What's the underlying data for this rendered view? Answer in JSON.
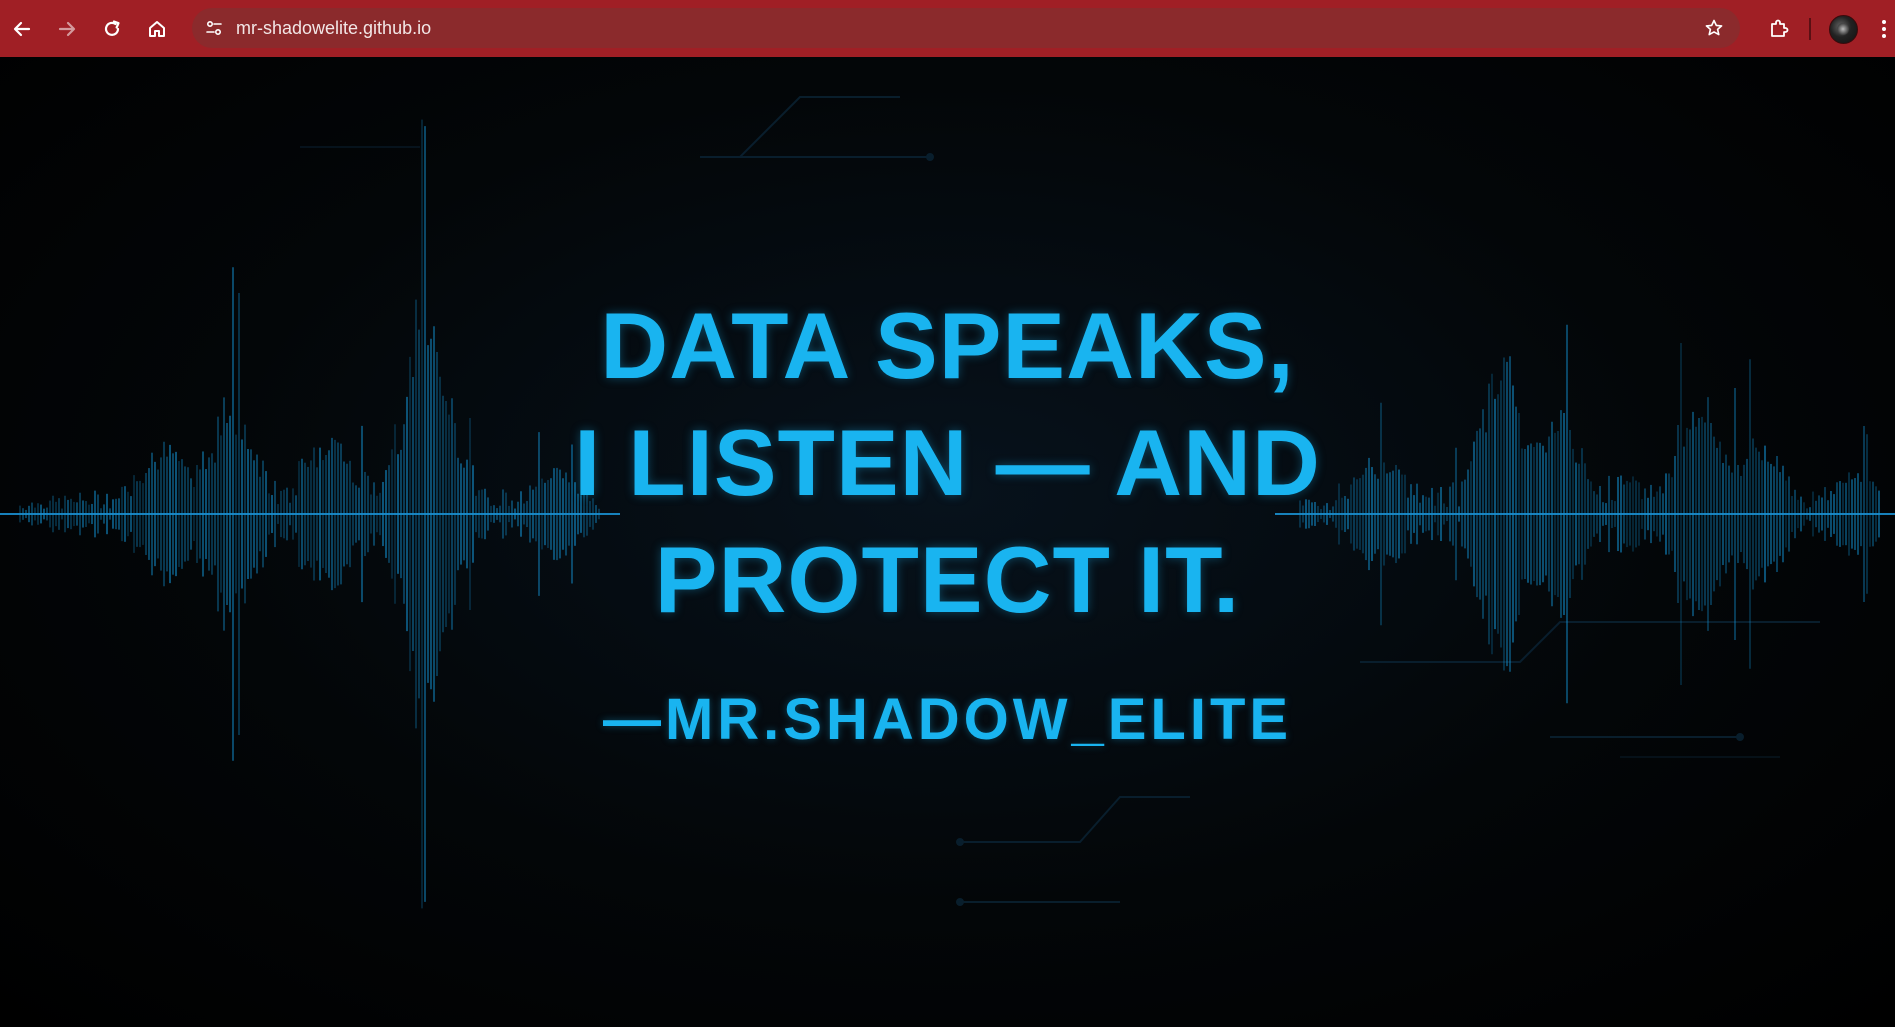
{
  "browser": {
    "url": "mr-shadowelite.github.io",
    "accent_color": "#a01f25",
    "icons": {
      "back": "arrow-left-icon",
      "forward": "arrow-right-icon",
      "reload": "reload-icon",
      "home": "home-icon",
      "site_info": "tune-icon",
      "bookmark": "star-icon",
      "extensions": "puzzle-icon",
      "profile": "avatar",
      "menu": "kebab-menu-icon"
    }
  },
  "page": {
    "background_color": "#000000",
    "text_color": "#19b4f0",
    "quote_lines": [
      "DATA SPEAKS,",
      "I LISTEN — AND",
      "PROTECT IT."
    ],
    "attribution": "—MR.SHADOW_ELITE"
  }
}
